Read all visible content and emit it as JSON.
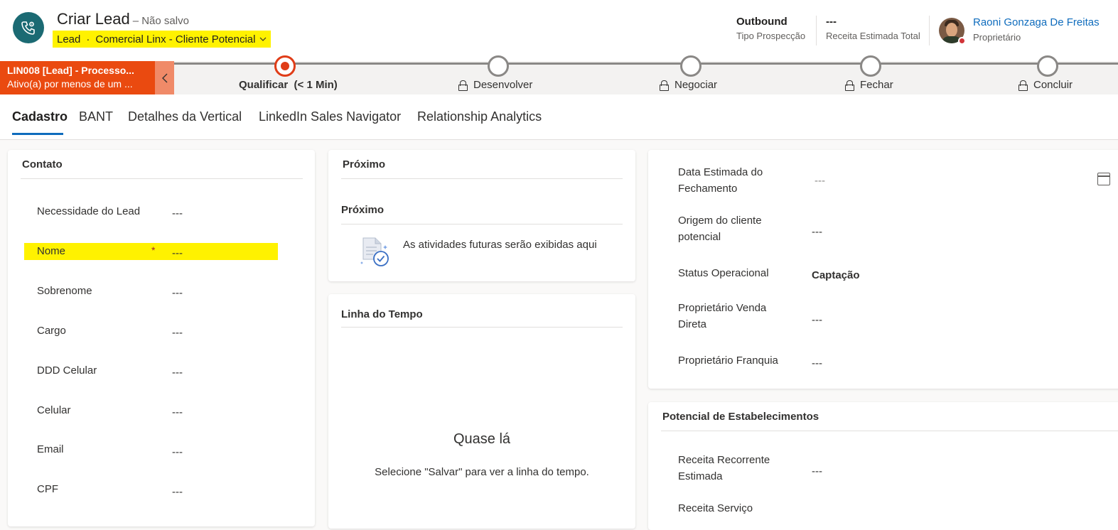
{
  "header": {
    "title": "Criar Lead",
    "title_suffix": "– Não salvo",
    "form_selector": {
      "entity": "Lead",
      "separator": "·",
      "form_name": "Comercial Linx - Cliente Potencial"
    },
    "fields": [
      {
        "value": "Outbound",
        "label": "Tipo Prospecção"
      },
      {
        "value": "---",
        "label": "Receita Estimada Total"
      }
    ],
    "owner": {
      "name": "Raoni Gonzaga De Freitas",
      "label": "Proprietário",
      "presence_color": "#d13438"
    }
  },
  "bpf": {
    "process_name": "LIN008 [Lead] - Processo...",
    "status": "Ativo(a) por menos de um ...",
    "accent_color": "#ea4a10",
    "stages": [
      {
        "label": "Qualificar",
        "duration": "(< 1 Min)",
        "active": true
      },
      {
        "label": "Desenvolver",
        "locked": true
      },
      {
        "label": "Negociar",
        "locked": true
      },
      {
        "label": "Fechar",
        "locked": true
      },
      {
        "label": "Concluir",
        "locked": true
      }
    ]
  },
  "tabs": [
    "Cadastro",
    "BANT",
    "Detalhes da Vertical",
    "LinkedIn Sales Navigator",
    "Relationship Analytics"
  ],
  "contato": {
    "title": "Contato",
    "fields": [
      {
        "label": "Necessidade do Lead",
        "value": "---"
      },
      {
        "label": "Nome",
        "value": "---",
        "required_mark": "*"
      },
      {
        "label": "Sobrenome",
        "value": "---"
      },
      {
        "label": "Cargo",
        "value": "---"
      },
      {
        "label": "DDD Celular",
        "value": "---"
      },
      {
        "label": "Celular",
        "value": "---"
      },
      {
        "label": "Email",
        "value": "---"
      },
      {
        "label": "CPF",
        "value": "---"
      }
    ]
  },
  "proximo": {
    "title": "Próximo",
    "subtitle": "Próximo",
    "empty_text": "As atividades futuras serão exibidas aqui"
  },
  "timeline": {
    "title": "Linha do Tempo",
    "empty_title": "Quase lá",
    "empty_text": "Selecione \"Salvar\" para ver a linha do tempo."
  },
  "details": {
    "fields": [
      {
        "label_lines": [
          "Data Estimada do",
          "Fechamento"
        ],
        "value": "---",
        "icon": "calendar-icon"
      },
      {
        "label_lines": [
          "Origem do cliente",
          "potencial"
        ],
        "value": "---"
      },
      {
        "label_lines": [
          "Status Operacional"
        ],
        "value": "Captação"
      },
      {
        "label_lines": [
          "Proprietário Venda",
          "Direta"
        ],
        "value": "---"
      },
      {
        "label_lines": [
          "Proprietário Franquia"
        ],
        "value": "---"
      }
    ]
  },
  "potencial": {
    "title": "Potencial de Estabelecimentos",
    "fields": [
      {
        "label_lines": [
          "Receita Recorrente",
          "Estimada"
        ],
        "value": "---"
      },
      {
        "label_lines": [
          "Receita Serviço"
        ],
        "value": ""
      }
    ]
  }
}
